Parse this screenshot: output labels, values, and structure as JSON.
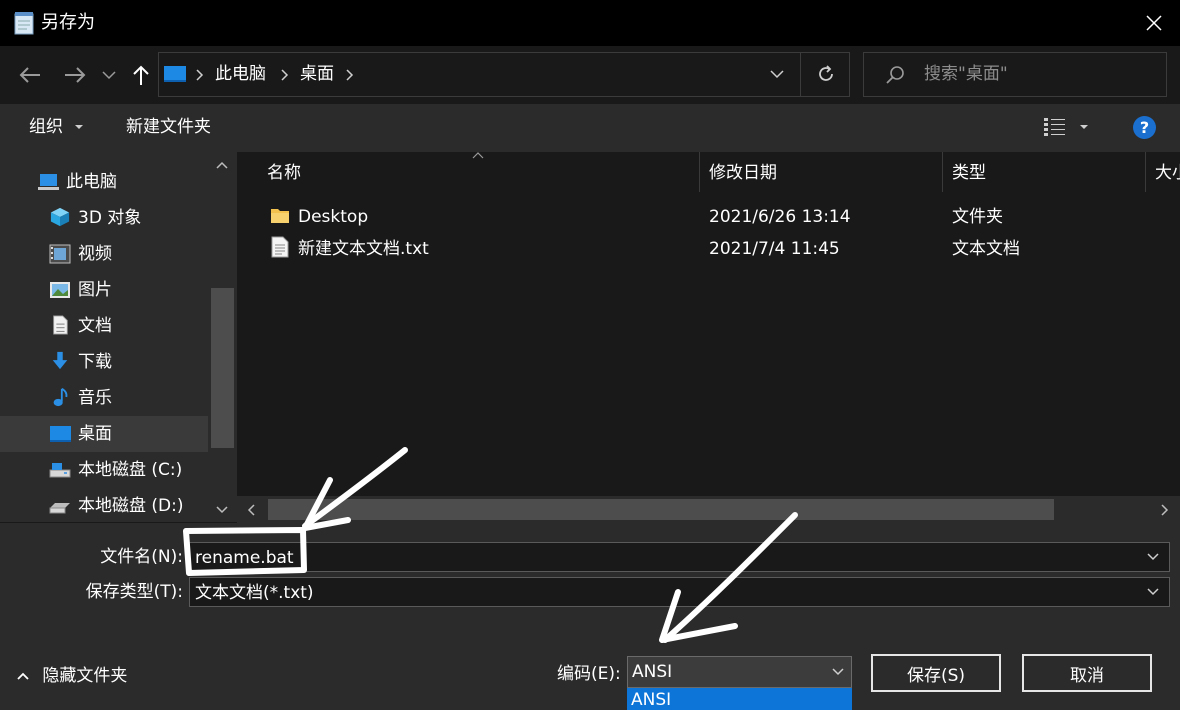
{
  "window": {
    "title": "另存为"
  },
  "address": {
    "segments": [
      "此电脑",
      "桌面"
    ]
  },
  "search": {
    "placeholder": "搜索\"桌面\""
  },
  "toolbar": {
    "organize_label": "组织",
    "new_folder_label": "新建文件夹",
    "help_label": "?"
  },
  "sidebar": {
    "items": [
      {
        "label": "此电脑",
        "icon": "computer-icon"
      },
      {
        "label": "3D 对象",
        "icon": "3d-objects-icon"
      },
      {
        "label": "视频",
        "icon": "video-icon"
      },
      {
        "label": "图片",
        "icon": "pictures-icon"
      },
      {
        "label": "文档",
        "icon": "documents-icon"
      },
      {
        "label": "下载",
        "icon": "download-icon"
      },
      {
        "label": "音乐",
        "icon": "music-icon"
      },
      {
        "label": "桌面",
        "icon": "desktop-icon"
      },
      {
        "label": "本地磁盘 (C:)",
        "icon": "drive-icon"
      },
      {
        "label": "本地磁盘 (D:)",
        "icon": "drive-icon"
      }
    ],
    "selected": "桌面"
  },
  "file_list": {
    "columns": [
      "名称",
      "修改日期",
      "类型",
      "大小"
    ],
    "rows": [
      {
        "name": "Desktop",
        "date": "2021/6/26 13:14",
        "type": "文件夹",
        "icon": "folder-icon"
      },
      {
        "name": "新建文本文档.txt",
        "date": "2021/7/4 11:45",
        "type": "文本文档",
        "icon": "text-file-icon"
      }
    ]
  },
  "form": {
    "filename_label": "文件名(N):",
    "filename_value": "rename.bat",
    "filetype_label": "保存类型(T):",
    "filetype_value": "文本文档(*.txt)",
    "encoding_label": "编码(E):",
    "encoding_value": "ANSI",
    "encoding_highlight": "ANSI"
  },
  "footer": {
    "hide_folders_label": "隐藏文件夹",
    "save_label": "保存(S)",
    "cancel_label": "取消"
  },
  "colors": {
    "accent": "#0d74d8",
    "background": "#191919",
    "panel": "#2b2b2b"
  }
}
